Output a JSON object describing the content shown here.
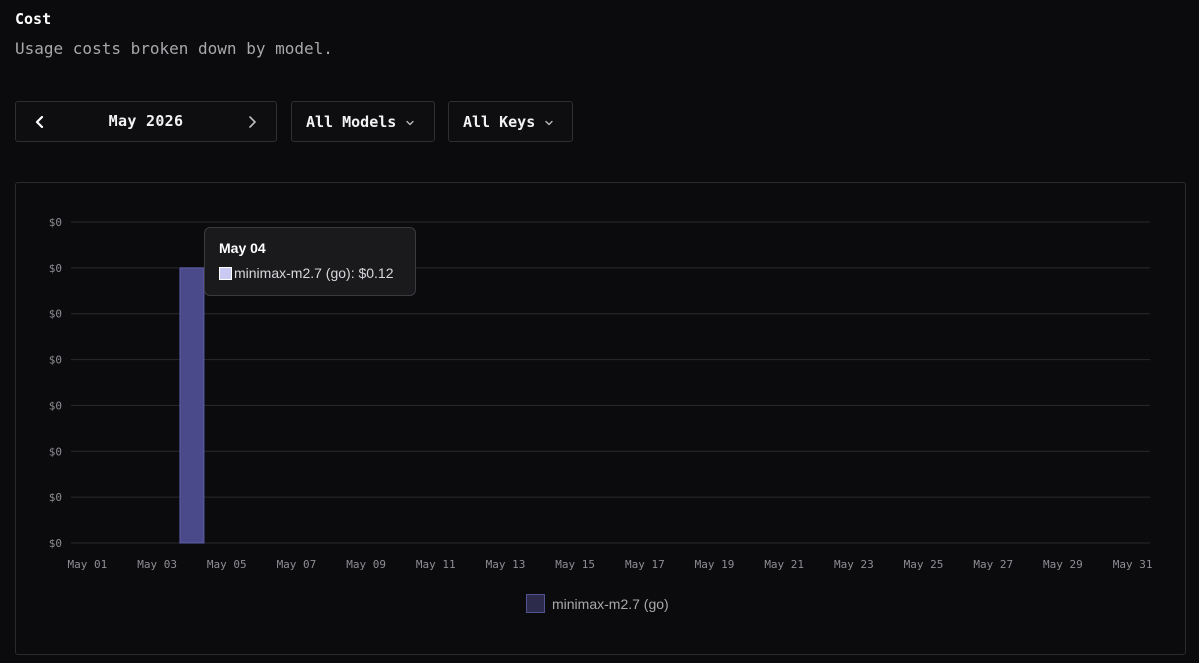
{
  "header": {
    "title": "Cost",
    "subtitle": "Usage costs broken down by model."
  },
  "controls": {
    "month": "May 2026",
    "models_label": "All Models",
    "keys_label": "All Keys"
  },
  "icons": {
    "prev": "chevron-left-icon",
    "next": "chevron-right-icon",
    "dropdown": "chevron-down-icon"
  },
  "colors": {
    "bar_fill": "#4a4a8a",
    "bar_stroke": "#5e5ea8",
    "tooltip_swatch": "#c9c9f3"
  },
  "tooltip": {
    "date": "May 04",
    "label": "minimax-m2.7 (go): $0.12"
  },
  "legend": {
    "series_name": "minimax-m2.7 (go)"
  },
  "chart_data": {
    "type": "bar",
    "title": "",
    "xlabel": "",
    "ylabel": "",
    "categories": [
      "May 01",
      "May 02",
      "May 03",
      "May 04",
      "May 05",
      "May 06",
      "May 07",
      "May 08",
      "May 09",
      "May 10",
      "May 11",
      "May 12",
      "May 13",
      "May 14",
      "May 15",
      "May 16",
      "May 17",
      "May 18",
      "May 19",
      "May 20",
      "May 21",
      "May 22",
      "May 23",
      "May 24",
      "May 25",
      "May 26",
      "May 27",
      "May 28",
      "May 29",
      "May 30",
      "May 31"
    ],
    "x_tick_labels": [
      "May 01",
      "May 03",
      "May 05",
      "May 07",
      "May 09",
      "May 11",
      "May 13",
      "May 15",
      "May 17",
      "May 19",
      "May 21",
      "May 23",
      "May 25",
      "May 27",
      "May 29",
      "May 31"
    ],
    "y_tick_labels": [
      "$0",
      "$0",
      "$0",
      "$0",
      "$0",
      "$0",
      "$0",
      "$0"
    ],
    "ylim": [
      0,
      0.14
    ],
    "grid": true,
    "legend_position": "bottom",
    "series": [
      {
        "name": "minimax-m2.7 (go)",
        "values": [
          0,
          0,
          0,
          0.12,
          0,
          0,
          0,
          0,
          0,
          0,
          0,
          0,
          0,
          0,
          0,
          0,
          0,
          0,
          0,
          0,
          0,
          0,
          0,
          0,
          0,
          0,
          0,
          0,
          0,
          0,
          0
        ]
      }
    ]
  }
}
